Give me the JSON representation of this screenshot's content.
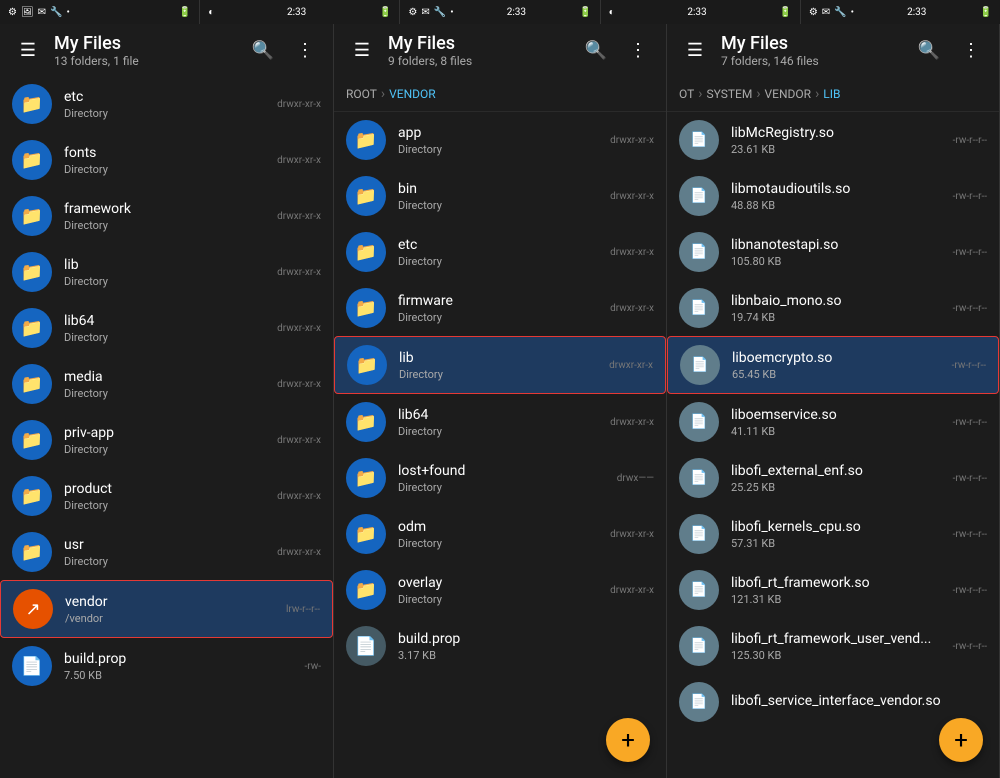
{
  "statusBar": {
    "panels": [
      {
        "left": [
          "⚙",
          "🖼",
          "✉",
          "🔧",
          "•"
        ],
        "time": "",
        "right": [
          "🔋"
        ]
      },
      {
        "left": [
          "◐"
        ],
        "time": "2:33",
        "right": [
          "🔋"
        ]
      },
      {
        "left": [
          "⚙",
          "✉",
          "🔧",
          "•"
        ],
        "time": "2:33",
        "right": [
          "🔋"
        ]
      },
      {
        "left": [
          "◐"
        ],
        "time": "2:33",
        "right": [
          "🔋"
        ]
      },
      {
        "left": [
          "⚙",
          "✉",
          "🔧",
          "•"
        ],
        "time": "",
        "right": []
      },
      {
        "left": [],
        "time": "2:33",
        "right": []
      }
    ]
  },
  "panels": [
    {
      "title": "My Files",
      "subtitle": "13 folders, 1 file",
      "breadcrumb": [],
      "files": [
        {
          "name": "etc",
          "meta": "Directory",
          "perm": "drwxr-xr-x",
          "type": "folder",
          "selected": false
        },
        {
          "name": "fonts",
          "meta": "Directory",
          "perm": "drwxr-xr-x",
          "type": "folder",
          "selected": false
        },
        {
          "name": "framework",
          "meta": "Directory",
          "perm": "drwxr-xr-x",
          "type": "folder",
          "selected": false
        },
        {
          "name": "lib",
          "meta": "Directory",
          "perm": "drwxr-xr-x",
          "type": "folder",
          "selected": false
        },
        {
          "name": "lib64",
          "meta": "Directory",
          "perm": "drwxr-xr-x",
          "type": "folder",
          "selected": false
        },
        {
          "name": "media",
          "meta": "Directory",
          "perm": "drwxr-xr-x",
          "type": "folder",
          "selected": false
        },
        {
          "name": "priv-app",
          "meta": "Directory",
          "perm": "drwxr-xr-x",
          "type": "folder",
          "selected": false
        },
        {
          "name": "product",
          "meta": "Directory",
          "perm": "drwxr-xr-x",
          "type": "folder",
          "selected": false
        },
        {
          "name": "usr",
          "meta": "Directory",
          "perm": "drwxr-xr-x",
          "type": "folder",
          "selected": false
        },
        {
          "name": "vendor",
          "meta": "/vendor",
          "perm": "lrw-r--r--",
          "type": "link",
          "selected": true
        },
        {
          "name": "build.prop",
          "meta": "7.50 KB",
          "perm": "-rw-",
          "type": "doc",
          "selected": false
        }
      ],
      "hasFab": false
    },
    {
      "title": "My Files",
      "subtitle": "9 folders, 8 files",
      "breadcrumb": [
        {
          "label": "ROOT",
          "active": false
        },
        {
          "label": ">",
          "isSep": true
        },
        {
          "label": "VENDOR",
          "active": true
        }
      ],
      "files": [
        {
          "name": "app",
          "meta": "Directory",
          "perm": "drwxr-xr-x",
          "type": "folder",
          "selected": false
        },
        {
          "name": "bin",
          "meta": "Directory",
          "perm": "drwxr-xr-x",
          "type": "folder",
          "selected": false
        },
        {
          "name": "etc",
          "meta": "Directory",
          "perm": "drwxr-xr-x",
          "type": "folder",
          "selected": false
        },
        {
          "name": "firmware",
          "meta": "Directory",
          "perm": "drwxr-xr-x",
          "type": "folder",
          "selected": false
        },
        {
          "name": "lib",
          "meta": "Directory",
          "perm": "drwxr-xr-x",
          "type": "folder",
          "selected": true
        },
        {
          "name": "lib64",
          "meta": "Directory",
          "perm": "drwxr-xr-x",
          "type": "folder",
          "selected": false
        },
        {
          "name": "lost+found",
          "meta": "Directory",
          "perm": "drwx——",
          "type": "folder",
          "selected": false
        },
        {
          "name": "odm",
          "meta": "Directory",
          "perm": "drwxr-xr-x",
          "type": "folder",
          "selected": false
        },
        {
          "name": "overlay",
          "meta": "Directory",
          "perm": "drwxr-xr-x",
          "type": "folder",
          "selected": false
        },
        {
          "name": "build.prop",
          "meta": "3.17 KB",
          "perm": "",
          "type": "doc",
          "selected": false
        }
      ],
      "hasFab": true
    },
    {
      "title": "My Files",
      "subtitle": "7 folders, 146 files",
      "breadcrumb": [
        {
          "label": "OT",
          "active": false
        },
        {
          "label": ">",
          "isSep": true
        },
        {
          "label": "SYSTEM",
          "active": false
        },
        {
          "label": ">",
          "isSep": true
        },
        {
          "label": "VENDOR",
          "active": false
        },
        {
          "label": ">",
          "isSep": true
        },
        {
          "label": "LIB",
          "active": true
        }
      ],
      "files": [
        {
          "name": "libMcRegistry.so",
          "meta": "23.61 KB",
          "perm": "-rw-r--r--",
          "type": "doc",
          "selected": false
        },
        {
          "name": "libmotaudioutils.so",
          "meta": "48.88 KB",
          "perm": "-rw-r--r--",
          "type": "doc",
          "selected": false
        },
        {
          "name": "libnanotestapi.so",
          "meta": "105.80 KB",
          "perm": "-rw-r--r--",
          "type": "doc",
          "selected": false
        },
        {
          "name": "libnbaio_mono.so",
          "meta": "19.74 KB",
          "perm": "-rw-r--r--",
          "type": "doc",
          "selected": false
        },
        {
          "name": "liboemcrypto.so",
          "meta": "65.45 KB",
          "perm": "-rw-r--r--",
          "type": "doc",
          "selected": true
        },
        {
          "name": "liboemservice.so",
          "meta": "41.11 KB",
          "perm": "-rw-r--r--",
          "type": "doc",
          "selected": false
        },
        {
          "name": "libofi_external_enf.so",
          "meta": "25.25 KB",
          "perm": "-rw-r--r--",
          "type": "doc",
          "selected": false
        },
        {
          "name": "libofi_kernels_cpu.so",
          "meta": "57.31 KB",
          "perm": "-rw-r--r--",
          "type": "doc",
          "selected": false
        },
        {
          "name": "libofi_rt_framework.so",
          "meta": "121.31 KB",
          "perm": "-rw-r--r--",
          "type": "doc",
          "selected": false
        },
        {
          "name": "libofi_rt_framework_user_vend...",
          "meta": "125.30 KB",
          "perm": "-rw-r--r--",
          "type": "doc",
          "selected": false
        },
        {
          "name": "libofi_service_interface_vendor.so",
          "meta": "",
          "perm": "",
          "type": "doc",
          "selected": false
        }
      ],
      "hasFab": true
    }
  ],
  "icons": {
    "menu": "☰",
    "search": "🔍",
    "more": "⋮",
    "folder": "📁",
    "link": "↗",
    "doc": "📄",
    "fab": "+"
  }
}
